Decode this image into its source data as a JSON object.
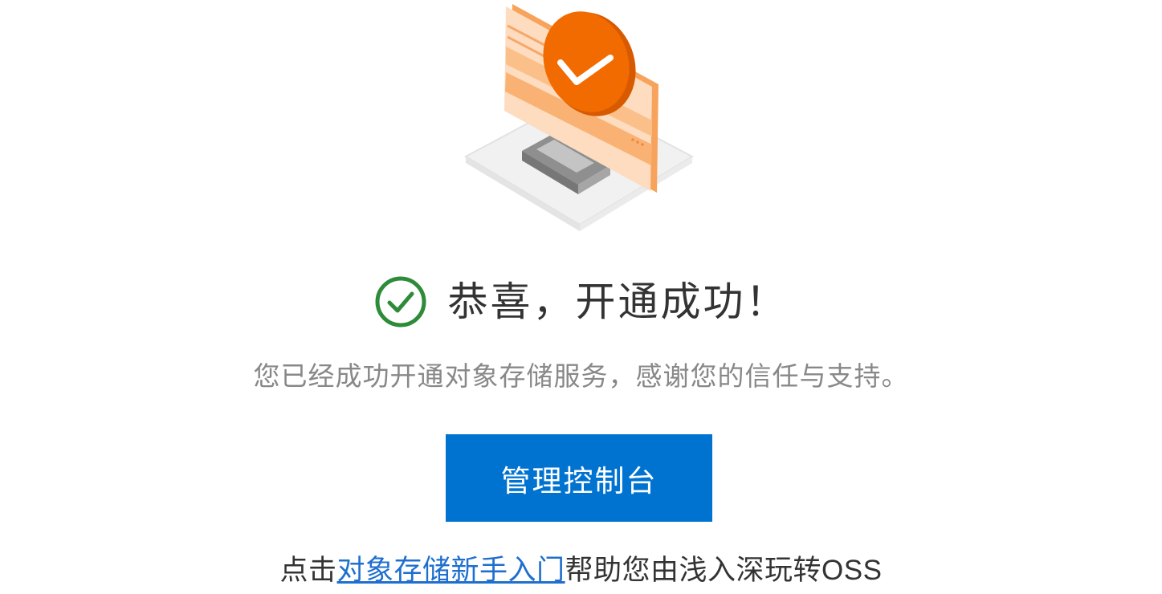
{
  "hero": {
    "illustration": "computer-checkmark-illustration",
    "accent_color": "#f26b00"
  },
  "success": {
    "icon": "check-circle-icon",
    "icon_color": "#2e8b3a",
    "title": "恭喜，开通成功！",
    "message": "您已经成功开通对象存储服务，感谢您的信任与支持。"
  },
  "actions": {
    "console_label": "管理控制台",
    "button_color": "#0073d1"
  },
  "help": {
    "prefix": "点击",
    "link_text": "对象存储新手入门",
    "suffix": "帮助您由浅入深玩转OSS"
  }
}
